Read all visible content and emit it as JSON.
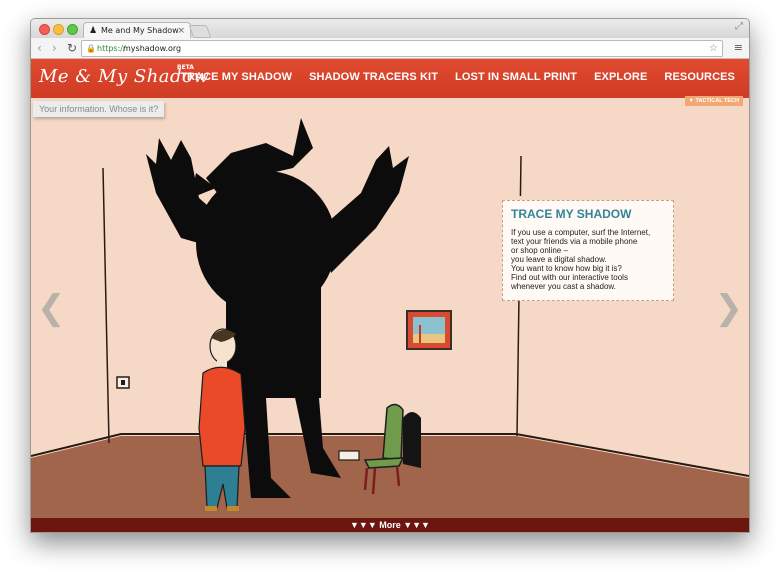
{
  "browser": {
    "tab_title": "Me and My Shadow",
    "tab_close": "×",
    "url_scheme": "https://",
    "url_host": "myshadow.org",
    "back_icon": "‹",
    "forward_icon": "›",
    "reload_icon": "↻",
    "star_icon": "☆",
    "menu_icon": "≡"
  },
  "site": {
    "logo": "Me & My Shadow",
    "beta": "BETA",
    "nav": [
      "Trace My Shadow",
      "Shadow Tracers Kit",
      "Lost in Small Print",
      "Explore",
      "Resources"
    ],
    "badge": "▼ TACTICAL TECH",
    "info_label": "Your information. Whose is it?"
  },
  "infobox": {
    "title": "Trace My Shadow",
    "body": "If you use a computer, surf the Internet,\ntext your friends via a mobile phone\nor shop online –\nyou leave a digital shadow.\nYou want to know how big it is?\nFind out with our interactive tools\nwhenever you cast a shadow."
  },
  "carousel": {
    "prev_icon": "❮",
    "next_icon": "❯"
  },
  "more": {
    "text": "▼▼▼ More ▼▼▼"
  },
  "colors": {
    "header_red": "#d8432a",
    "wall": "#f6d8c6",
    "floor": "#a0654b",
    "more_bar": "#6b1710",
    "title_teal": "#34839a"
  }
}
